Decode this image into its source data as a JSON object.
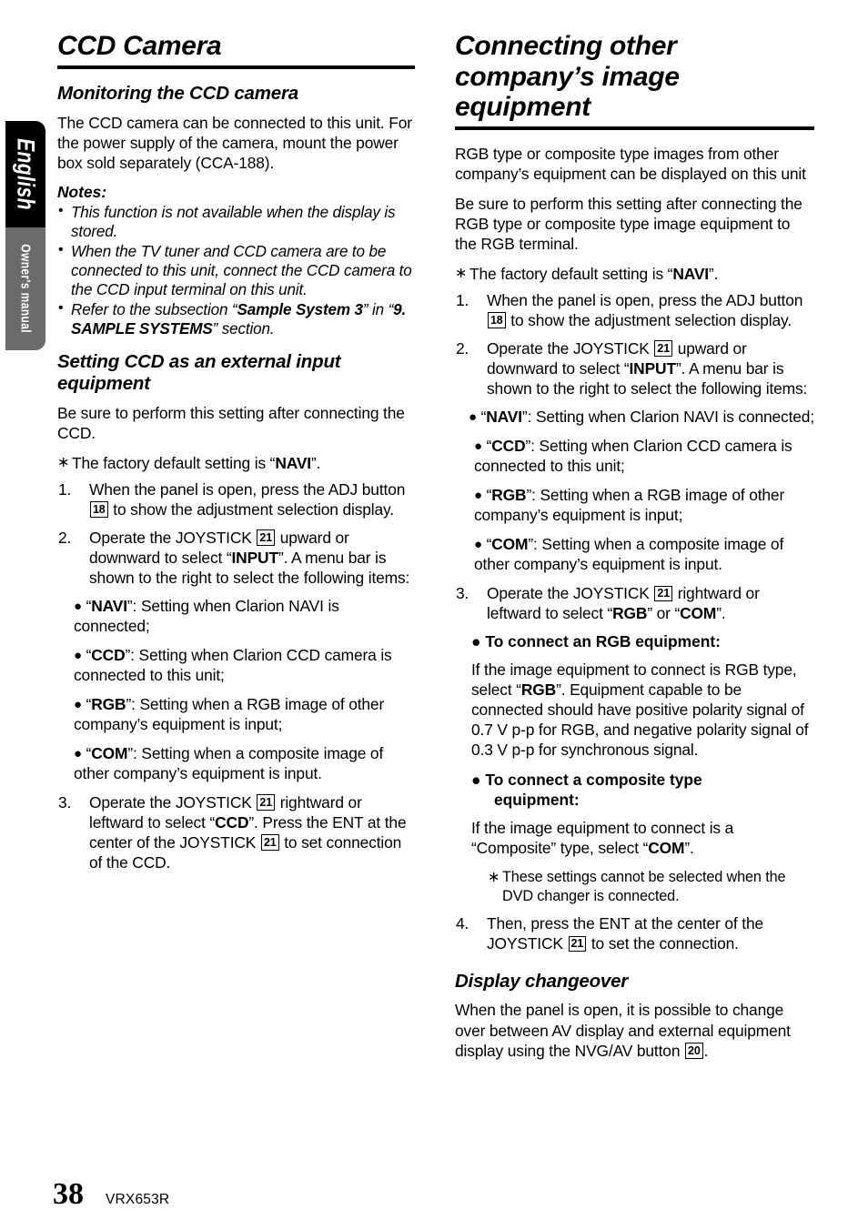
{
  "side_tab": {
    "language": "English",
    "manual": "Owner's manual"
  },
  "left_column": {
    "title": "CCD Camera",
    "section_monitoring": {
      "heading": "Monitoring the CCD camera",
      "intro": "The CCD camera can be connected to this unit. For the power supply of the camera, mount the power box sold separately (CCA-188).",
      "notes_label": "Notes:",
      "notes": [
        "This function is not available when the display is stored.",
        "When the TV tuner and CCD camera are to be connected to this unit, connect the CCD camera to the CCD input terminal on this unit."
      ],
      "note_refer_prefix": "Refer to the subsection “",
      "note_refer_bold1": "Sample System 3",
      "note_refer_mid": "” in “",
      "note_refer_bold2": "9. SAMPLE SYSTEMS",
      "note_refer_suffix": "” section."
    },
    "section_setting": {
      "heading": "Setting CCD as an external input equipment",
      "intro": "Be sure to perform this setting after connecting the CCD.",
      "factory_note_prefix": "The factory default setting is “",
      "factory_note_bold": "NAVI",
      "factory_note_suffix": "”.",
      "steps": [
        {
          "num": "1.",
          "part1": "When the panel is open, press the ADJ button ",
          "key": "18",
          "part2": " to show the adjustment selection display."
        },
        {
          "num": "2.",
          "part1": "Operate the JOYSTICK ",
          "key": "21",
          "part2": " upward or downward to select “",
          "bold": "INPUT",
          "part3": "”. A menu bar is shown to the right to select the following items:"
        }
      ],
      "bullets": [
        {
          "label": "NAVI",
          "text": ": Setting when Clarion NAVI is connected;"
        },
        {
          "label": "CCD",
          "text": ": Setting when Clarion CCD camera is connected to this unit;"
        },
        {
          "label": "RGB",
          "text": ": Setting when a RGB image of other company’s equipment is input;"
        },
        {
          "label": "COM",
          "text": ": Setting when a composite image of other company’s equipment is input."
        }
      ],
      "step3": {
        "num": "3.",
        "part1": "Operate the JOYSTICK ",
        "key1": "21",
        "part2": " rightward or leftward to select “",
        "bold1": "CCD",
        "part3": "”.  Press the ENT at the center of the JOYSTICK ",
        "key2": "21",
        "part4": " to set connection of the CCD."
      }
    }
  },
  "right_column": {
    "title": "Connecting other company’s image equipment",
    "intro1": "RGB type or composite type images from other company’s equipment can be displayed on this unit",
    "intro2": "Be sure to perform this setting after connecting the RGB type or composite type image equipment to the RGB terminal.",
    "factory_note_prefix": "The factory default setting is “",
    "factory_note_bold": "NAVI",
    "factory_note_suffix": "”.",
    "steps": [
      {
        "num": "1.",
        "part1": "When the panel is open, press the ADJ button ",
        "key": "18",
        "part2": " to show the adjustment selection display."
      },
      {
        "num": "2.",
        "part1": "Operate the JOYSTICK ",
        "key": "21",
        "part2": " upward or downward to select “",
        "bold": "INPUT",
        "part3": "”. A menu bar is shown to the right to select the following items:"
      }
    ],
    "bullets": [
      {
        "label": "NAVI",
        "text": ": Setting when Clarion NAVI is connected;"
      },
      {
        "label": "CCD",
        "text": ": Setting when Clarion CCD camera is connected to this unit;"
      },
      {
        "label": "RGB",
        "text": ": Setting when a RGB image of other company’s equipment is input;"
      },
      {
        "label": "COM",
        "text": ": Setting when a composite image of other company’s equipment is input."
      }
    ],
    "step3": {
      "num": "3.",
      "part1": "Operate the JOYSTICK ",
      "key1": "21",
      "part2": " rightward or leftward to select “",
      "bold1": "RGB",
      "part3": "” or “",
      "bold2": "COM",
      "part4": "”."
    },
    "rgb_head": "To connect an RGB equipment:",
    "rgb_body_part1": "If the image equipment to connect is RGB type, select “",
    "rgb_body_bold": "RGB",
    "rgb_body_part2": "”. Equipment capable to be connected should have positive polarity signal of 0.7 V p-p for RGB, and negative polarity signal of 0.3 V p-p for synchronous signal.",
    "composite_head_line1": "To connect a composite type",
    "composite_head_line2": "equipment:",
    "composite_body_part1": "If the image equipment to connect is a “Composite” type, select “",
    "composite_body_bold": "COM",
    "composite_body_part2": "”.",
    "dvd_note": "These settings cannot be selected when the DVD changer is connected.",
    "step4": {
      "num": "4.",
      "part1": "Then, press the ENT at the center of the JOYSTICK ",
      "key": "21",
      "part2": " to set the connection."
    },
    "display_changeover": {
      "heading": "Display changeover",
      "body_part1": "When the panel is open, it is possible to change over between AV display and external equipment display using the NVG/AV button ",
      "key": "20",
      "body_part2": "."
    }
  },
  "footer": {
    "page_number": "38",
    "model": "VRX653R"
  }
}
